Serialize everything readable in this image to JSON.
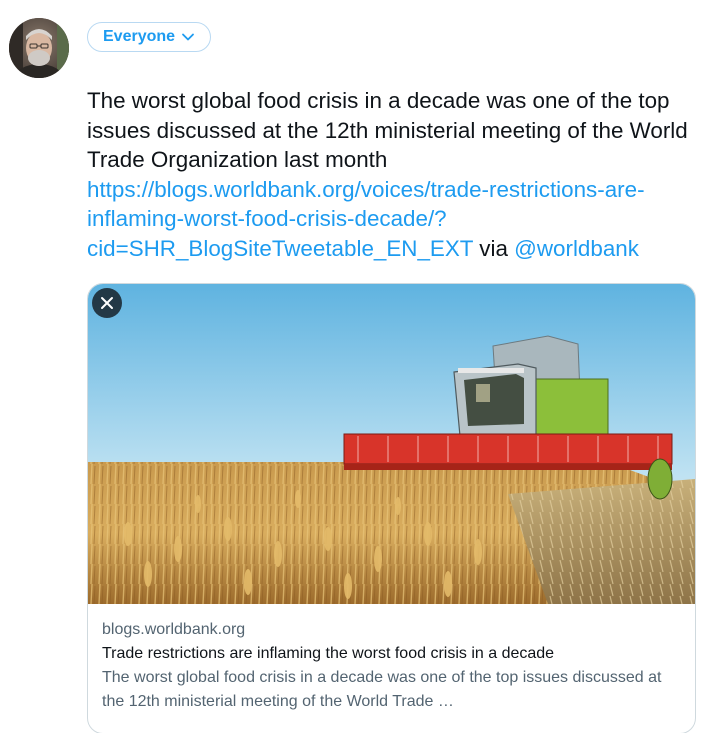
{
  "audience": {
    "label": "Everyone",
    "icon": "chevron-down-icon"
  },
  "tweet": {
    "text": "The worst global food crisis in a decade was one of the top issues discussed at the 12th ministerial meeting of the World Trade Organization last month",
    "url_line_1": "https://blogs.worldbank.org/voices/trade-restrictions-",
    "url_line_2": "are-inflaming-worst-food-crisis-decade/?",
    "url_line_3": "cid=SHR_BlogSiteTweetable_EN_EXT",
    "via": "via",
    "mention": "@worldbank"
  },
  "card": {
    "domain": "blogs.worldbank.org",
    "title": "Trade restrictions are inflaming the worst food crisis in a decade",
    "description": "The worst global food crisis in a decade was one of the top issues discussed at the 12th ministerial meeting of the World Trade …",
    "close_icon": "close-icon"
  },
  "colors": {
    "accent": "#1d9bf0",
    "text": "#0f1419",
    "secondary": "#536471",
    "border": "#cfd9de"
  }
}
